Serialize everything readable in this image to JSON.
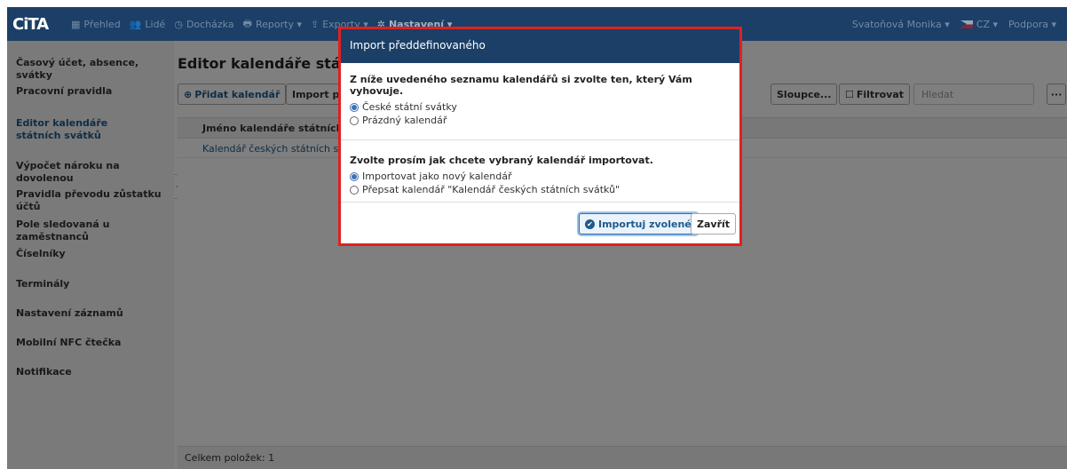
{
  "navbar": {
    "logo_text": "CiTA",
    "items": [
      {
        "icon": "grid-icon",
        "glyph": "▦",
        "label": "Přehled"
      },
      {
        "icon": "users-icon",
        "glyph": "👥",
        "label": "Lidé"
      },
      {
        "icon": "clock-icon",
        "glyph": "◷",
        "label": "Docházka"
      },
      {
        "icon": "printer-icon",
        "glyph": "🖶",
        "label": "Reporty ▾"
      },
      {
        "icon": "export-icon",
        "glyph": "⇪",
        "label": "Exporty ▾"
      },
      {
        "icon": "gear-icon",
        "glyph": "✲",
        "label": "Nastavení ▾"
      }
    ],
    "user": "Svatoňová Monika ▾",
    "language": "CZ ▾",
    "support": "Podpora ▾"
  },
  "sidebar": {
    "items": [
      {
        "label": "Časový účet, absence, svátky"
      },
      {
        "label": "Pracovní pravidla"
      },
      {
        "label": "Editor kalendáře státních svátků",
        "active": true
      },
      {
        "label": "Výpočet nároku na dovolenou"
      },
      {
        "label": "Pravidla převodu zůstatku účtů"
      },
      {
        "label": "Pole sledovaná u zaměstnanců"
      },
      {
        "label": "Číselníky"
      },
      {
        "label": "Terminály"
      },
      {
        "label": "Nastavení záznamů"
      },
      {
        "label": "Mobilní NFC čtečka"
      },
      {
        "label": "Notifikace"
      }
    ]
  },
  "main": {
    "title": "Editor kalendáře státních svátků",
    "add_button": "Přidat kalendář",
    "import_button": "Import předdefinovaného",
    "columns_button": "Sloupce...",
    "filter_button": "Filtrovat",
    "search_placeholder": "Hledat",
    "more_button": "···",
    "table": {
      "header": "Jméno kalendáře státních svátků",
      "rows": [
        "Kalendář českých státních svátků"
      ]
    },
    "footer": "Celkem položek: 1"
  },
  "modal": {
    "title": "Import předdefinovaného",
    "question1": "Z níže uvedeného seznamu kalendářů si zvolte ten, který Vám vyhovuje.",
    "options1": [
      {
        "label": "České státní svátky",
        "selected": true
      },
      {
        "label": "Prázdný kalendář",
        "selected": false
      }
    ],
    "question2": "Zvolte prosím jak chcete vybraný kalendář importovat.",
    "options2": [
      {
        "label": "Importovat jako nový kalendář",
        "selected": true
      },
      {
        "label": "Přepsat kalendář \"Kalendář českých státních svátků\"",
        "selected": false
      }
    ],
    "import_button": "Importuj zvolené",
    "close_button": "Zavřít"
  },
  "colors": {
    "navbar": "#1b3f66",
    "accent": "#1e5a8c",
    "highlight_border": "#e02020"
  }
}
